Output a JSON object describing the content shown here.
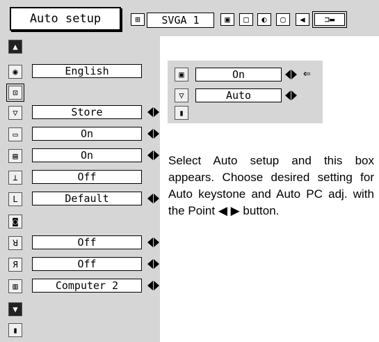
{
  "header": {
    "title": "Auto setup",
    "source_label": "SVGA 1",
    "icons": [
      "input-icon",
      "display-icon",
      "screen-icon",
      "image-icon",
      "setting-icon",
      "sound-icon",
      "menu-close-icon"
    ]
  },
  "menu": {
    "items": [
      {
        "icon": "scroll-up-icon",
        "value": ""
      },
      {
        "icon": "language-icon",
        "value": "English"
      },
      {
        "icon": "auto-setup-icon",
        "value": ""
      },
      {
        "icon": "keystone-icon",
        "value": "Store"
      },
      {
        "icon": "blue-back-icon",
        "value": "On"
      },
      {
        "icon": "display-icon",
        "value": "On"
      },
      {
        "icon": "ceiling-icon",
        "value": "Off"
      },
      {
        "icon": "logo-icon",
        "value": "Default"
      },
      {
        "icon": "capture-icon",
        "value": ""
      },
      {
        "icon": "ceiling-mirror-icon",
        "value": "Off"
      },
      {
        "icon": "rear-icon",
        "value": "Off"
      },
      {
        "icon": "terminal-icon",
        "value": "Computer 2"
      },
      {
        "icon": "scroll-down-icon",
        "value": ""
      },
      {
        "icon": "exit-icon",
        "value": ""
      }
    ]
  },
  "submenu": {
    "auto_pc_adj": "On",
    "auto_keystone": "Auto",
    "exit_label": ""
  },
  "description": "Select Auto setup and this box appears.  Choose desired setting for Auto keystone and Auto PC adj. with the Point ◀ ▶ button."
}
